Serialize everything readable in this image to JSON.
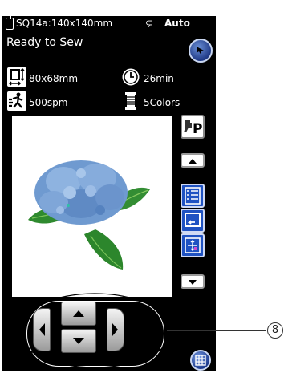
{
  "topbar": {
    "hoop_label": "SQ14a:140x140mm",
    "auto_label": "Auto",
    "thread_symbol": "⊊"
  },
  "status": {
    "text": "Ready to Sew"
  },
  "info": {
    "size": {
      "icon": "size-icon",
      "value": "80x68mm"
    },
    "time": {
      "icon": "clock-icon",
      "value": "26min"
    },
    "speed": {
      "icon": "speed-icon",
      "value": "500spm"
    },
    "colors": {
      "icon": "thread-spool-icon",
      "value": "5Colors"
    }
  },
  "side_buttons": {
    "presser_label": "P",
    "icons": [
      "presser-foot-icon",
      "scroll-up-icon",
      "color-list-icon",
      "frame-icon",
      "center-crosshair-icon",
      "scroll-down-icon"
    ]
  },
  "controls": {
    "icons": [
      "left-arrow-icon",
      "up-arrow-icon",
      "down-arrow-icon",
      "right-arrow-icon",
      "grid-icon"
    ]
  },
  "callout": {
    "number": "8"
  },
  "colors": {
    "screen_bg": "#000000",
    "accent_blue": "#1f52c2",
    "flower": "#6f9ad0",
    "leaf": "#2f8a2f"
  }
}
